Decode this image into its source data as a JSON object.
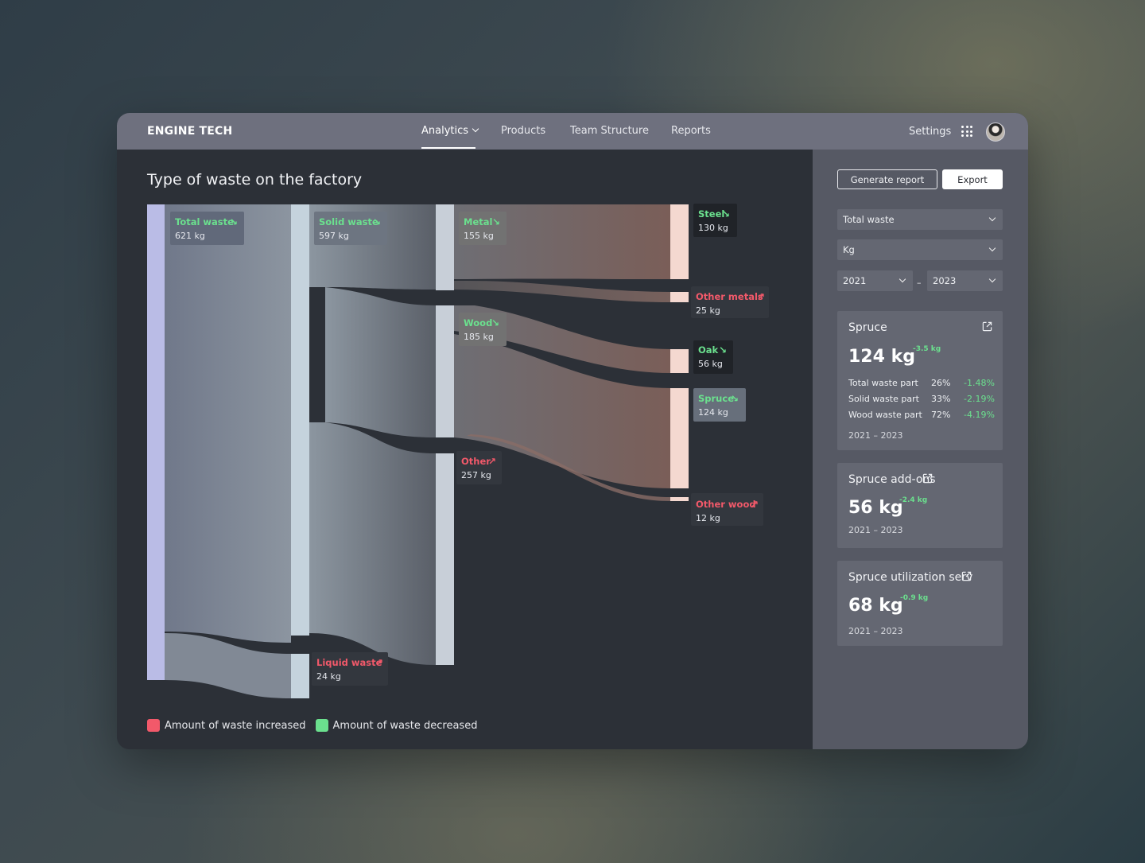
{
  "app": {
    "brand": "ENGINE TECH",
    "nav": [
      {
        "label": "Analytics",
        "active": true,
        "has_dropdown": true
      },
      {
        "label": "Products"
      },
      {
        "label": "Team Structure"
      },
      {
        "label": "Reports"
      }
    ],
    "settings_label": "Settings",
    "apps_icon": "grid-dots-icon",
    "avatar_icon": "user-avatar"
  },
  "main": {
    "title": "Type of waste on the factory",
    "legend": [
      {
        "label": "Amount of waste increased",
        "color": "#f2596a"
      },
      {
        "label": "Amount of waste decreased",
        "color": "#6be08e"
      }
    ]
  },
  "colors": {
    "increase": "#f2596a",
    "decrease": "#6be08e"
  },
  "sankey": {
    "nodes": [
      {
        "id": "total",
        "name": "Total waste",
        "value": "621 kg",
        "trend": "down"
      },
      {
        "id": "solid",
        "name": "Solid waste",
        "value": "597 kg",
        "trend": "down"
      },
      {
        "id": "liquid",
        "name": "Liquid waste",
        "value": "24 kg",
        "trend": "up"
      },
      {
        "id": "metal",
        "name": "Metal",
        "value": "155 kg",
        "trend": "down"
      },
      {
        "id": "wood",
        "name": "Wood",
        "value": "185 kg",
        "trend": "down"
      },
      {
        "id": "other",
        "name": "Other",
        "value": "257 kg",
        "trend": "up"
      },
      {
        "id": "steel",
        "name": "Steel",
        "value": "130 kg",
        "trend": "down"
      },
      {
        "id": "othermetals",
        "name": "Other metals",
        "value": "25 kg",
        "trend": "up"
      },
      {
        "id": "oak",
        "name": "Oak",
        "value": "56 kg",
        "trend": "down"
      },
      {
        "id": "spruce",
        "name": "Spruce",
        "value": "124 kg",
        "trend": "down",
        "selected": true
      },
      {
        "id": "otherwood",
        "name": "Other wood",
        "value": "12 kg",
        "trend": "up"
      }
    ]
  },
  "side": {
    "generate_label": "Generate report",
    "export_label": "Export",
    "filters": {
      "metric": "Total waste",
      "unit": "Kg",
      "year_from": "2021",
      "range_sep": "–",
      "year_to": "2023"
    },
    "cards": [
      {
        "title": "Spruce",
        "value": "124 kg",
        "delta": "-3.5 kg",
        "stats": [
          {
            "label": "Total waste part",
            "pct": "26%",
            "change": "-1.48%"
          },
          {
            "label": "Solid waste part",
            "pct": "33%",
            "change": "-2.19%"
          },
          {
            "label": "Wood waste part",
            "pct": "72%",
            "change": "-4.19%"
          }
        ],
        "range": "2021 – 2023"
      },
      {
        "title": "Spruce add-ons",
        "value": "56 kg",
        "delta": "-2.4 kg",
        "range": "2021 – 2023"
      },
      {
        "title": "Spruce utilization serv",
        "value": "68 kg",
        "delta": "-0.9 kg",
        "range": "2021 – 2023"
      }
    ]
  }
}
